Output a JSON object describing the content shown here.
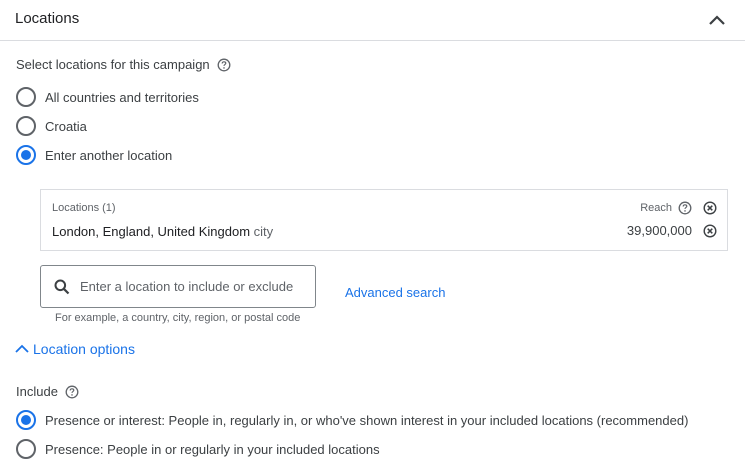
{
  "header": {
    "title": "Locations"
  },
  "select": {
    "label": "Select locations for this campaign"
  },
  "location_radios": [
    {
      "label": "All countries and territories",
      "checked": false
    },
    {
      "label": "Croatia",
      "checked": false
    },
    {
      "label": "Enter another location",
      "checked": true
    }
  ],
  "locations_box": {
    "heading": "Locations (1)",
    "reach_label": "Reach",
    "item": {
      "name": "London, England, United Kingdom",
      "type": "city",
      "reach": "39,900,000"
    }
  },
  "search": {
    "placeholder": "Enter a location to include or exclude",
    "value": "",
    "hint": "For example, a country, city, region, or postal code"
  },
  "advanced_search": "Advanced search",
  "location_options": {
    "toggle_label": "Location options",
    "include_label": "Include",
    "include_radios": [
      {
        "label": "Presence or interest: People in, regularly in, or who've shown interest in your included locations (recommended)",
        "checked": true
      },
      {
        "label": "Presence: People in or regularly in your included locations",
        "checked": false
      }
    ]
  },
  "colors": {
    "accent": "#1a73e8",
    "text": "#3c4043",
    "border": "#dadce0"
  },
  "icons": [
    "chevron-up-icon",
    "help-icon",
    "close-circle-icon",
    "search-icon"
  ]
}
